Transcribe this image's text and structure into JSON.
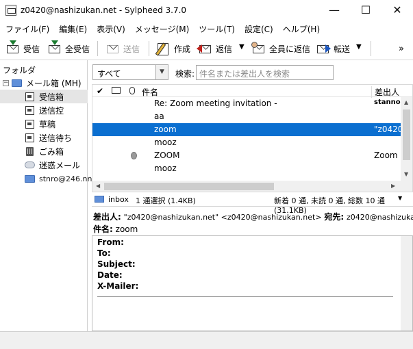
{
  "window": {
    "title": "z0420@nashizukan.net - Sylpheed 3.7.0",
    "minimize": "—",
    "maximize": "☐",
    "close": "✕"
  },
  "menu": [
    "ファイル(F)",
    "編集(E)",
    "表示(V)",
    "メッセージ(M)",
    "ツール(T)",
    "設定(C)",
    "ヘルプ(H)"
  ],
  "toolbar": {
    "receive": "受信",
    "receive_all": "全受信",
    "send": "送信",
    "compose": "作成",
    "reply": "返信",
    "reply_all": "全員に返信",
    "forward": "転送",
    "more": "»"
  },
  "folders": {
    "header": "フォルダ",
    "mailbox": "メール箱 (MH)",
    "items": [
      "受信箱",
      "送信控",
      "草稿",
      "送信待ち",
      "ごみ箱",
      "迷惑メール"
    ],
    "account": "stnro@246.nn"
  },
  "search": {
    "filter": "すべて",
    "label": "検索:",
    "placeholder": "件名または差出人を検索"
  },
  "list": {
    "columns": {
      "check": "✔",
      "subject": "件名",
      "from": "差出人"
    },
    "rows": [
      {
        "subject": "Re: Zoom meeting invitation -",
        "from": "stanno",
        "selected": false,
        "attach": false
      },
      {
        "subject": "aa",
        "from": "",
        "selected": false,
        "attach": false
      },
      {
        "subject": "zoom",
        "from": "\"z0420",
        "selected": true,
        "attach": false
      },
      {
        "subject": "mooz",
        "from": "",
        "selected": false,
        "attach": false
      },
      {
        "subject": "ZOOM",
        "from": "Zoom",
        "selected": false,
        "attach": true
      },
      {
        "subject": "mooz",
        "from": "",
        "selected": false,
        "attach": false
      }
    ]
  },
  "status": {
    "folder": "inbox",
    "selection": "1 通選択 (1.4KB)",
    "counts": "新着 0 通, 未読 0 通, 総数 10 通 (31.1KB)"
  },
  "header_view": {
    "from_label": "差出人:",
    "from_value": "\"z0420@nashizukan.net\" <z0420@nashizukan.net>",
    "to_label": "宛先:",
    "to_value": "z0420@nashizukan.net",
    "subject_label": "件名:",
    "subject_value": "zoom"
  },
  "body": {
    "fields": [
      "From:",
      "To:",
      "Subject:",
      "Date:",
      "X-Mailer:"
    ]
  }
}
